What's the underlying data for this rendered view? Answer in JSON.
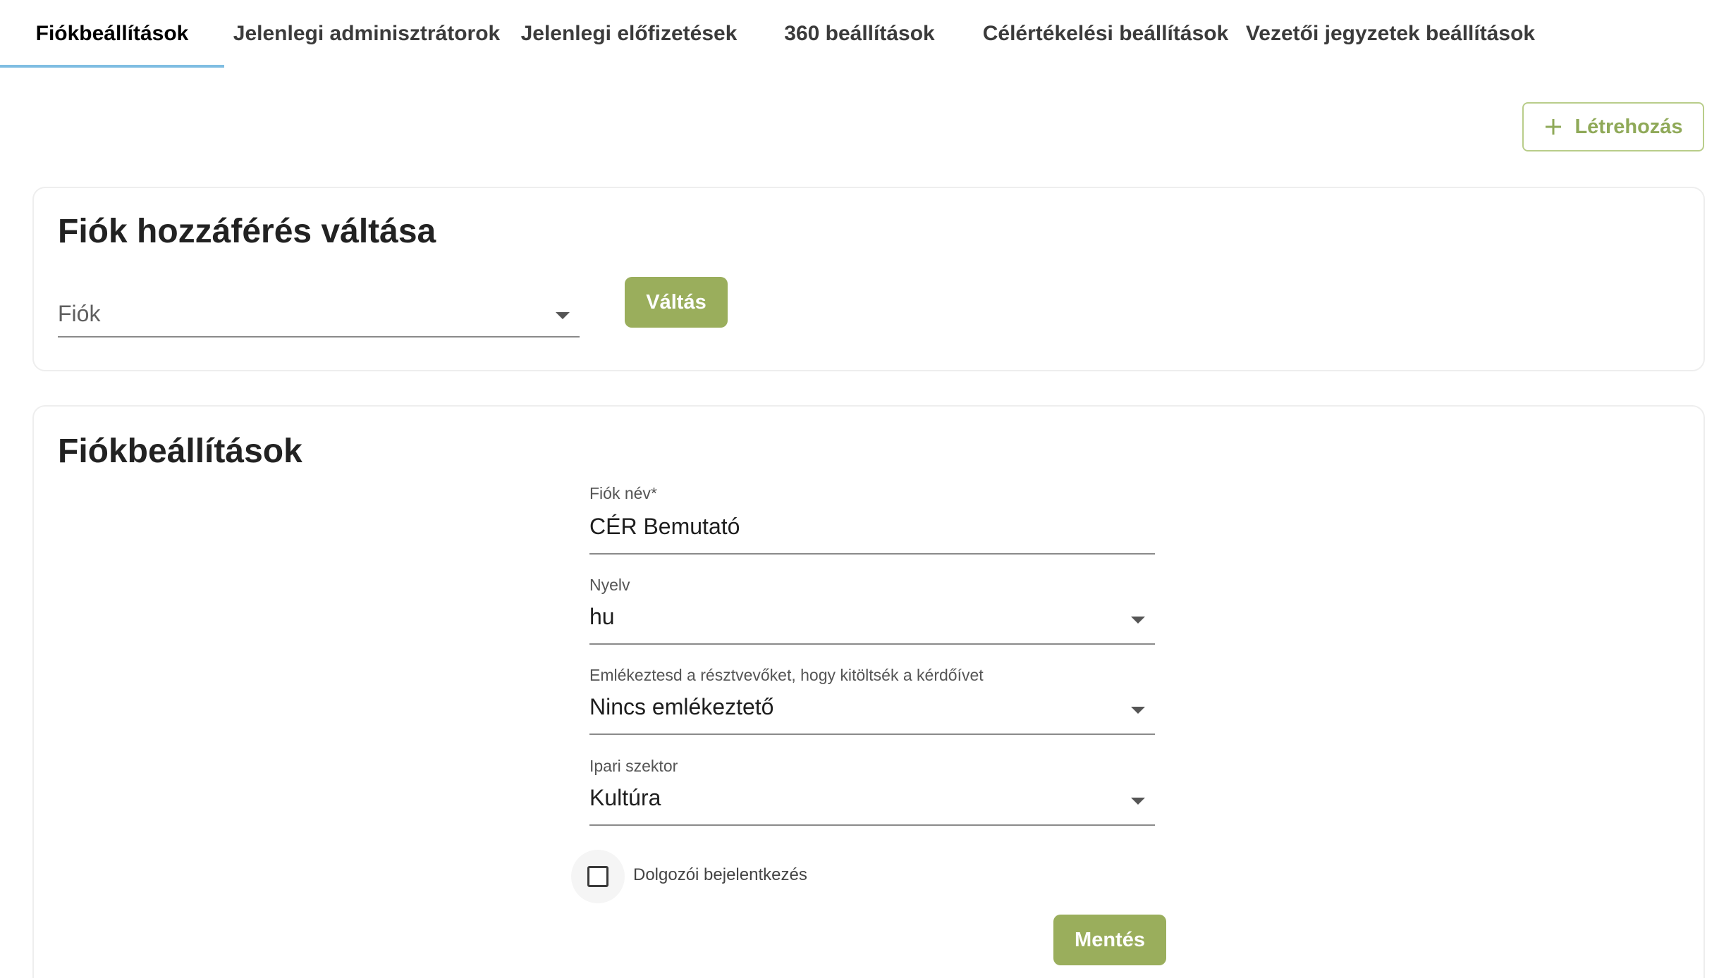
{
  "tabs": [
    {
      "label": "Fiókbeállítások",
      "active": true
    },
    {
      "label": "Jelenlegi adminisztrátorok",
      "active": false
    },
    {
      "label": "Jelenlegi előfizetések",
      "active": false
    },
    {
      "label": "360 beállítások",
      "active": false
    },
    {
      "label": "Célértékelési beállítások",
      "active": false
    },
    {
      "label": "Vezetői jegyzetek beállítások",
      "active": false
    }
  ],
  "toolbar": {
    "create_label": "Létrehozás",
    "create_icon": "plus-icon"
  },
  "switch_card": {
    "title": "Fiók hozzáférés váltása",
    "account_placeholder": "Fiók",
    "switch_label": "Váltás"
  },
  "settings_card": {
    "title": "Fiókbeállítások",
    "account_name": {
      "label": "Fiók név",
      "required_mark": "*",
      "value": "CÉR Bemutató"
    },
    "language": {
      "label": "Nyelv",
      "value": "hu"
    },
    "reminder": {
      "label": "Emlékeztesd a résztvevőket, hogy kitöltsék a kérdőívet",
      "value": "Nincs emlékeztető"
    },
    "sector": {
      "label": "Ipari szektor",
      "value": "Kultúra"
    },
    "employee_login": {
      "label": "Dolgozói bejelentkezés",
      "checked": false
    },
    "save_label": "Mentés"
  },
  "colors": {
    "accent_green": "#9aae5c",
    "tab_indicator": "#7fbde2"
  }
}
